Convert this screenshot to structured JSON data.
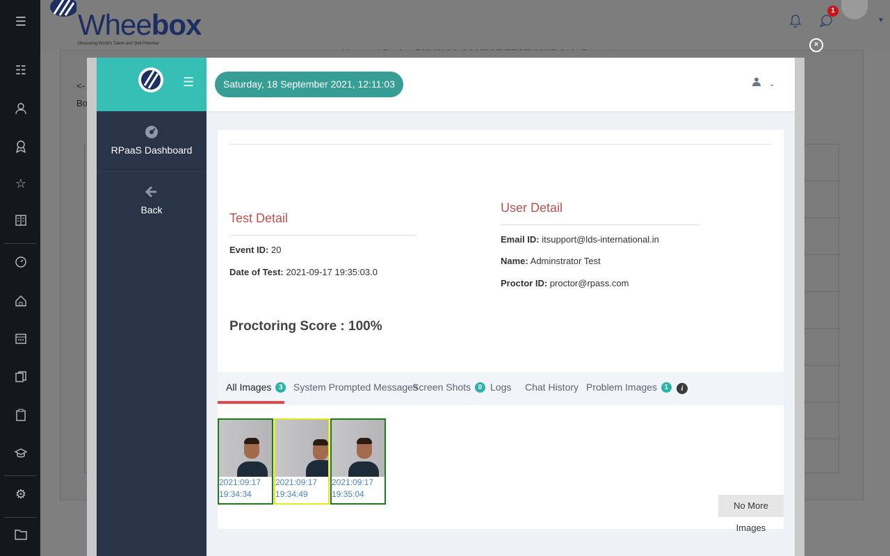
{
  "app": {
    "logo_text_light": "Whee",
    "logo_text_bold": "box",
    "logo_tagline": "Measuring World's Talent and Skill Potential",
    "viewing_prefix": "You are Viewing ",
    "viewing_bold": "PHYSICS COURSE TEST QUIZ",
    "viewing_suffix": " Quiz Reports",
    "notification_badge": "1",
    "back_arrow": "<-",
    "back_partial": "Bo"
  },
  "modal": {
    "close_label": "×",
    "sidebar": {
      "menu_icon": "hamburger-icon",
      "items": [
        {
          "label": "RPaaS Dashboard",
          "icon": "dashboard-icon"
        },
        {
          "label": "Back",
          "icon": "back-arrow-icon"
        }
      ]
    },
    "topbar": {
      "datetime": "Saturday, 18 September 2021, 12:11:03",
      "user_caret": "⌄"
    },
    "test_detail": {
      "title": "Test Detail",
      "event_label": "Event ID:",
      "event_value": "20",
      "date_label": "Date of Test:",
      "date_value": "2021-09-17 19:35:03.0"
    },
    "user_detail": {
      "title": "User Detail",
      "email_label": "Email ID:",
      "email_value": "itsupport@lds-international.in",
      "name_label": "Name:",
      "name_value": "Adminstrator Test",
      "proctor_label": "Proctor ID:",
      "proctor_value": "proctor@rpass.com"
    },
    "proctoring_score": "Proctoring Score : 100%",
    "tabs": [
      {
        "label": "All Images",
        "count": "3",
        "active": true
      },
      {
        "label": "System Prompted Messages"
      },
      {
        "label": "Screen Shots",
        "count": "0"
      },
      {
        "label": "Logs"
      },
      {
        "label": "Chat History"
      },
      {
        "label": "Problem Images",
        "count": "1"
      }
    ],
    "info_icon": "i",
    "images": [
      {
        "date": "2021:09:17",
        "time": "19:34:34",
        "status_color": "#1c7a1c"
      },
      {
        "date": "2021:09:17",
        "time": "19:34:49",
        "status_color": "#e8e820"
      },
      {
        "date": "2021:09:17",
        "time": "19:35:04",
        "status_color": "#1c7a1c"
      }
    ],
    "no_more_images": "No More Images"
  },
  "colors": {
    "teal": "#36bfb4",
    "sidebar_dark": "#2a3449",
    "section_title": "#c0504d",
    "active_tab": "#e0464b",
    "badge": "#2bb3a6"
  }
}
